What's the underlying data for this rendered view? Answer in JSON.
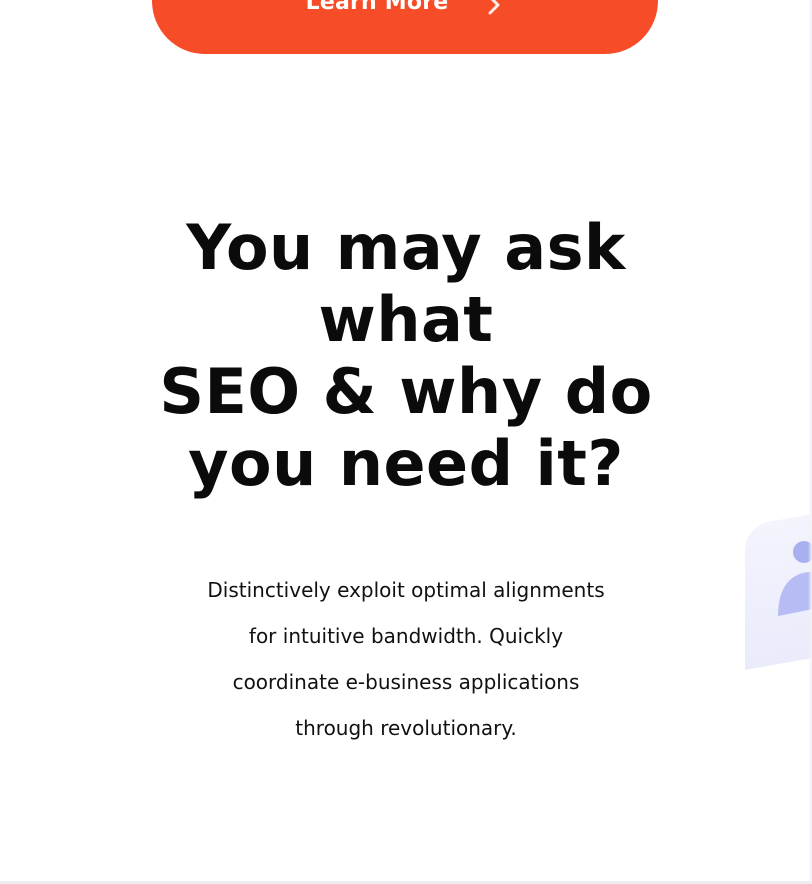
{
  "cta": {
    "label": "Learn More",
    "icon": "chevron-right-icon",
    "color": "#f74c28"
  },
  "headline": {
    "lines": [
      "You may ask",
      "what",
      "SEO & why do",
      "you need it?"
    ]
  },
  "description": {
    "lines": [
      "Distinctively exploit optimal alignments",
      "for intuitive bandwidth. Quickly",
      "coordinate e-business applications",
      "through revolutionary."
    ]
  },
  "decoration": {
    "icon": "person-illustration-icon",
    "accent_color": "#9aa3ee"
  }
}
